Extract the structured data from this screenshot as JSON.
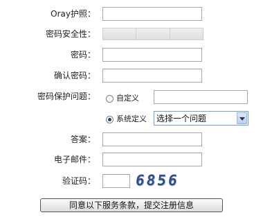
{
  "form": {
    "oray_id_label": "Oray护照：",
    "strength_label": "密码安全性：",
    "password_label": "密码：",
    "confirm_label": "确认密码：",
    "question_label": "密码保护问题：",
    "custom_option": "自定义",
    "system_option": "系统定义",
    "select_value": "选择一个问题",
    "answer_label": "答案：",
    "email_label": "电子邮件：",
    "captcha_label": "验证码：",
    "captcha_code": "6856",
    "submit_label": "同意以下服务条款，提交注册信息"
  }
}
